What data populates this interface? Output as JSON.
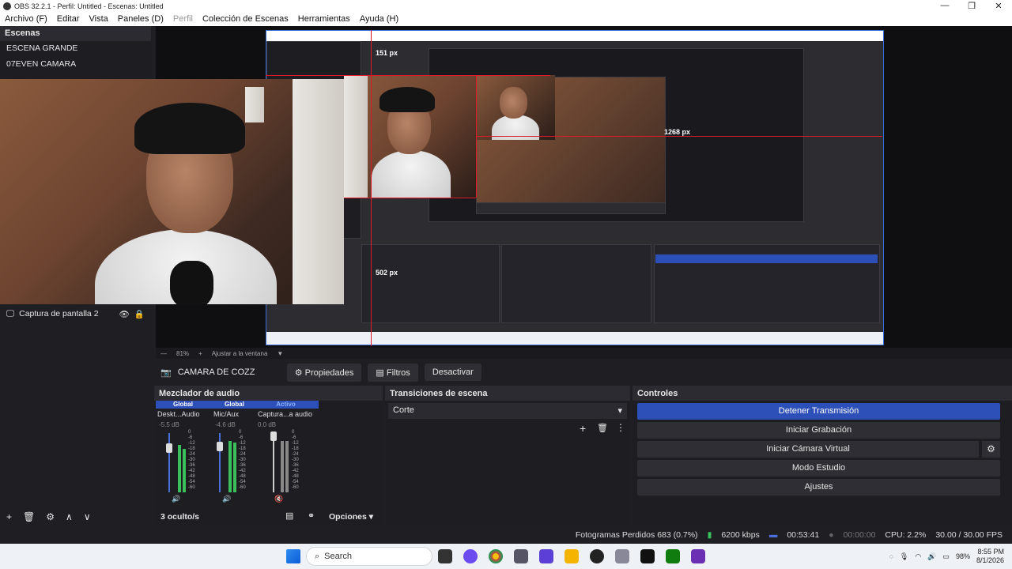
{
  "window": {
    "title": "OBS 32.2.1 - Perfil: Untitled - Escenas: Untitled"
  },
  "menu": [
    "Archivo (F)",
    "Editar",
    "Vista",
    "Paneles (D)",
    "Perfil",
    "Colección de Escenas",
    "Herramientas",
    "Ayuda (H)"
  ],
  "scenes": {
    "header": "Escenas",
    "items": [
      "ESCENA GRANDE",
      "07EVEN CAMARA"
    ]
  },
  "sources": {
    "item": "Captura de pantalla 2"
  },
  "zoom": {
    "level": "81%",
    "fit": "Ajustar a la ventana"
  },
  "source_toolbar": {
    "name": "CAMARA DE COZZ",
    "properties": "Propiedades",
    "filters": "Filtros",
    "deactivate": "Desactivar"
  },
  "mixer": {
    "header": "Mezclador de audio",
    "channels": [
      {
        "tag": "Global",
        "name": "Deskt...Audio",
        "db": "-5.5 dB"
      },
      {
        "tag": "Global",
        "name": "Mic/Aux",
        "db": "-4.6 dB"
      },
      {
        "tag": "Activo",
        "name": "Captura...a audio",
        "db": "0.0 dB"
      }
    ],
    "scale": "0 -6 -12 -18 -24 -30 -36 -42 -48 -54 -60",
    "hidden": "3 oculto/s",
    "options": "Opciones"
  },
  "transitions": {
    "header": "Transiciones de escena",
    "selected": "Corte"
  },
  "controls": {
    "header": "Controles",
    "buttons": [
      "Detener Transmisión",
      "Iniciar Grabación",
      "Iniciar Cámara Virtual",
      "Modo Estudio",
      "Ajustes"
    ]
  },
  "status": {
    "dropped": "Fotogramas Perdidos 683 (0.7%)",
    "bitrate": "6200 kbps",
    "stream_time": "00:53:41",
    "rec_time": "00:00:00",
    "cpu": "CPU: 2.2%",
    "fps": "30.00 / 30.00 FPS"
  },
  "guides": {
    "top": "151 px",
    "right": "1268 px",
    "left": "502 px"
  },
  "taskbar": {
    "search": "Search",
    "battery": "98%",
    "time": "8:55 PM",
    "date": "8/1/2026"
  },
  "colors": {
    "accent": "#2d4fb8",
    "guide": "#e0192a",
    "meter": "#3ac05a"
  }
}
